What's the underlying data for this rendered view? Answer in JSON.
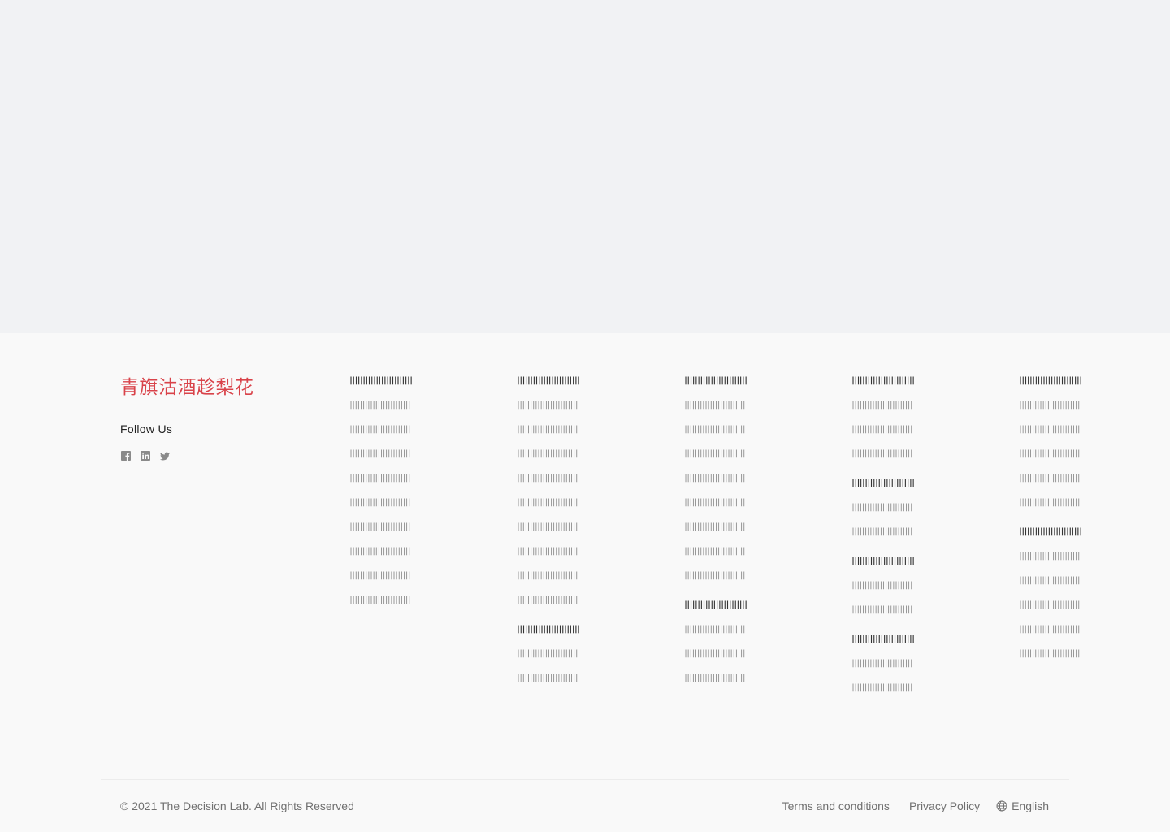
{
  "brand": {
    "name": "青旗沽酒趁梨花"
  },
  "follow": {
    "label": "Follow Us",
    "icons": [
      "facebook-icon",
      "linkedin-icon",
      "twitter-icon"
    ]
  },
  "columns": [
    {
      "groups": [
        {
          "title": "||||||||||||||||||||||||",
          "links": [
            "||||||||||||||||||||||||",
            "||||||||||||||||||||||||",
            "||||||||||||||||||||||||",
            "||||||||||||||||||||||||",
            "||||||||||||||||||||||||",
            "||||||||||||||||||||||||",
            "||||||||||||||||||||||||",
            "||||||||||||||||||||||||",
            "||||||||||||||||||||||||"
          ]
        }
      ]
    },
    {
      "groups": [
        {
          "title": "||||||||||||||||||||||||",
          "links": [
            "||||||||||||||||||||||||",
            "||||||||||||||||||||||||",
            "||||||||||||||||||||||||",
            "||||||||||||||||||||||||",
            "||||||||||||||||||||||||",
            "||||||||||||||||||||||||",
            "||||||||||||||||||||||||",
            "||||||||||||||||||||||||",
            "||||||||||||||||||||||||"
          ]
        },
        {
          "title": "||||||||||||||||||||||||",
          "links": [
            "||||||||||||||||||||||||",
            "||||||||||||||||||||||||"
          ]
        }
      ]
    },
    {
      "groups": [
        {
          "title": "||||||||||||||||||||||||",
          "links": [
            "||||||||||||||||||||||||",
            "||||||||||||||||||||||||",
            "||||||||||||||||||||||||",
            "||||||||||||||||||||||||",
            "||||||||||||||||||||||||",
            "||||||||||||||||||||||||",
            "||||||||||||||||||||||||",
            "||||||||||||||||||||||||"
          ]
        },
        {
          "title": "||||||||||||||||||||||||",
          "links": [
            "||||||||||||||||||||||||",
            "||||||||||||||||||||||||",
            "||||||||||||||||||||||||"
          ]
        }
      ]
    },
    {
      "groups": [
        {
          "title": "||||||||||||||||||||||||",
          "links": [
            "||||||||||||||||||||||||",
            "||||||||||||||||||||||||",
            "||||||||||||||||||||||||"
          ]
        },
        {
          "title": "||||||||||||||||||||||||",
          "links": [
            "||||||||||||||||||||||||",
            "||||||||||||||||||||||||"
          ]
        },
        {
          "title": "||||||||||||||||||||||||",
          "links": [
            "||||||||||||||||||||||||",
            "||||||||||||||||||||||||"
          ]
        },
        {
          "title": "||||||||||||||||||||||||",
          "links": [
            "||||||||||||||||||||||||",
            "||||||||||||||||||||||||"
          ]
        }
      ]
    },
    {
      "groups": [
        {
          "title": "||||||||||||||||||||||||",
          "links": [
            "||||||||||||||||||||||||",
            "||||||||||||||||||||||||",
            "||||||||||||||||||||||||",
            "||||||||||||||||||||||||",
            "||||||||||||||||||||||||"
          ]
        },
        {
          "title": "||||||||||||||||||||||||",
          "links": [
            "||||||||||||||||||||||||",
            "||||||||||||||||||||||||",
            "||||||||||||||||||||||||",
            "||||||||||||||||||||||||",
            "||||||||||||||||||||||||"
          ]
        }
      ]
    }
  ],
  "bottom": {
    "copyright": "© 2021 The Decision Lab. All Rights Reserved",
    "terms": "Terms and conditions",
    "privacy": "Privacy Policy",
    "language": "English"
  },
  "colors": {
    "brand": "#d9434a",
    "hero_bg": "#f1f2f4",
    "footer_bg": "#f9f9f9"
  }
}
